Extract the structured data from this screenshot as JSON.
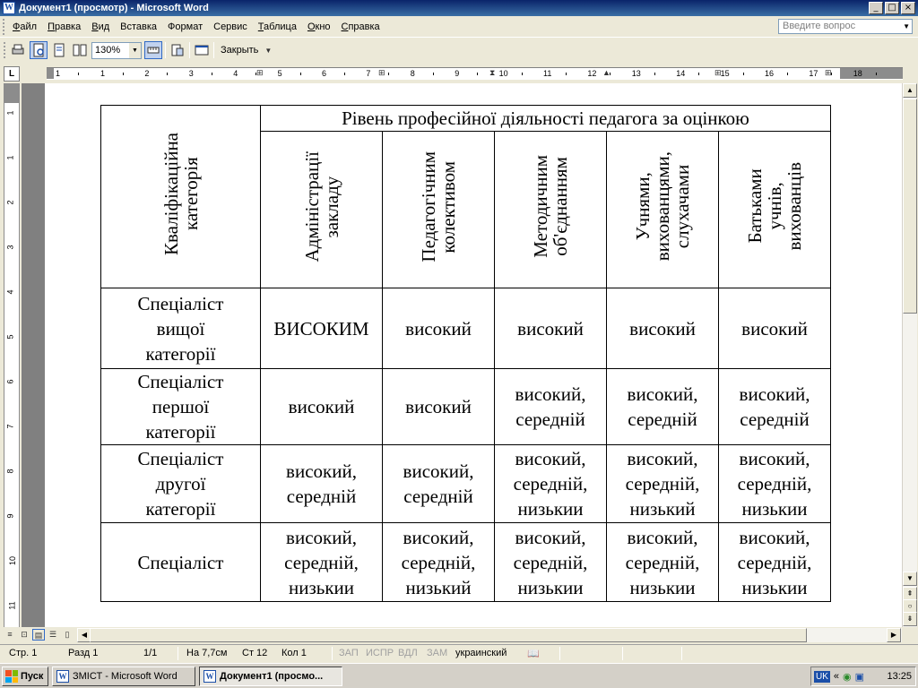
{
  "window": {
    "title": "Документ1 (просмотр) - Microsoft Word",
    "btn_min": "_",
    "btn_max": "□",
    "btn_close": "×"
  },
  "menu": {
    "items": [
      {
        "underline": "Ф",
        "rest": "айл"
      },
      {
        "underline": "П",
        "rest": "равка"
      },
      {
        "underline": "В",
        "rest": "ид"
      },
      {
        "underline": "",
        "rest": "Вставка"
      },
      {
        "underline": "",
        "rest": "Формат"
      },
      {
        "underline": "",
        "rest": "Сервис"
      },
      {
        "underline": "Т",
        "rest": "аблица"
      },
      {
        "underline": "О",
        "rest": "кно"
      },
      {
        "underline": "С",
        "rest": "правка"
      }
    ],
    "ask_placeholder": "Введите вопрос"
  },
  "toolbar": {
    "zoom": "130%",
    "close_label": "Закрыть"
  },
  "ruler": {
    "corner": "L",
    "h_numbers": [
      "1",
      "1",
      "2",
      "3",
      "4",
      "5",
      "6",
      "7",
      "8",
      "9",
      "10",
      "11",
      "12",
      "13",
      "14",
      "15",
      "16",
      "17",
      "18"
    ],
    "v_numbers": [
      "1",
      "1",
      "2",
      "3",
      "4",
      "5",
      "6",
      "7",
      "8",
      "9",
      "10",
      "11"
    ]
  },
  "table": {
    "row_header_title": "Кваліфікаційна\nкатегорія",
    "group_header": "Рівень професійної діяльності педагога за оцінкою",
    "columns": [
      "Адміністрації\nзакладу",
      "Педагогічним\nколективом",
      "Методичним\nоб'єднанням",
      "Учнями,\nвихованцями,\nслухачами",
      "Батьками\nучнів,\nвихованців"
    ],
    "rows": [
      {
        "category": "Спеціаліст\nвищої\nкатегорії",
        "cells": [
          "ВИСОКИМ",
          "високий",
          "високий",
          "високий",
          "високий"
        ]
      },
      {
        "category": "Спеціаліст\nпершої\nкатегорії",
        "cells": [
          "високий",
          "високий",
          "високий,\nсередній",
          "високий,\nсередній",
          "високий,\nсередній"
        ]
      },
      {
        "category": "Спеціаліст\nдругої\nкатегорії",
        "cells": [
          "високий,\nсередній",
          "високий,\nсередній",
          "високий,\nсередній,\nнизькии",
          "високий,\nсередній,\nнизький",
          "високий,\nсередній,\nнизькии"
        ]
      },
      {
        "category": "Спеціаліст",
        "cells": [
          "високий,\nсередній,\nнизькии",
          "високий,\nсередній,\nнизький",
          "високий,\nсередній,\nнизькии",
          "високий,\nсередній,\nнизькии",
          "високий,\nсередній,\nнизькии"
        ]
      }
    ]
  },
  "status": {
    "page": "Стр. 1",
    "section": "Разд 1",
    "pages": "1/1",
    "at": "На 7,7см",
    "line": "Ст 12",
    "col": "Кол 1",
    "rec": "ЗАП",
    "trk": "ИСПР",
    "ext": "ВДЛ",
    "ovr": "ЗАМ",
    "language": "украинский"
  },
  "taskbar": {
    "start": "Пуск",
    "tasks": [
      "ЗМІСТ - Microsoft Word",
      "Документ1 (просмо..."
    ],
    "lang": "UK",
    "clock": "13:25"
  }
}
